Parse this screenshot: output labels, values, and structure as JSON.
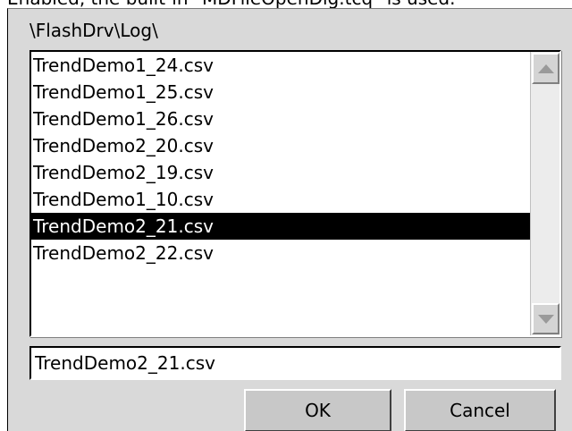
{
  "caption_fragment": "Enabled, the built-in \"MDFileOpenDlg.tcq\" is used.",
  "dialog": {
    "path": "\\FlashDrv\\Log\\",
    "files": [
      "TrendDemo1_24.csv",
      "TrendDemo1_25.csv",
      "TrendDemo1_26.csv",
      "TrendDemo2_20.csv",
      "TrendDemo2_19.csv",
      "TrendDemo1_10.csv",
      "TrendDemo2_21.csv",
      "TrendDemo2_22.csv"
    ],
    "selected_index": 6,
    "filename_value": "TrendDemo2_21.csv",
    "ok_label": "OK",
    "cancel_label": "Cancel",
    "scroll_up_icon": "arrow-up-icon",
    "scroll_down_icon": "arrow-down-icon",
    "selection_bg": "#000000",
    "selection_fg": "#ffffff"
  }
}
